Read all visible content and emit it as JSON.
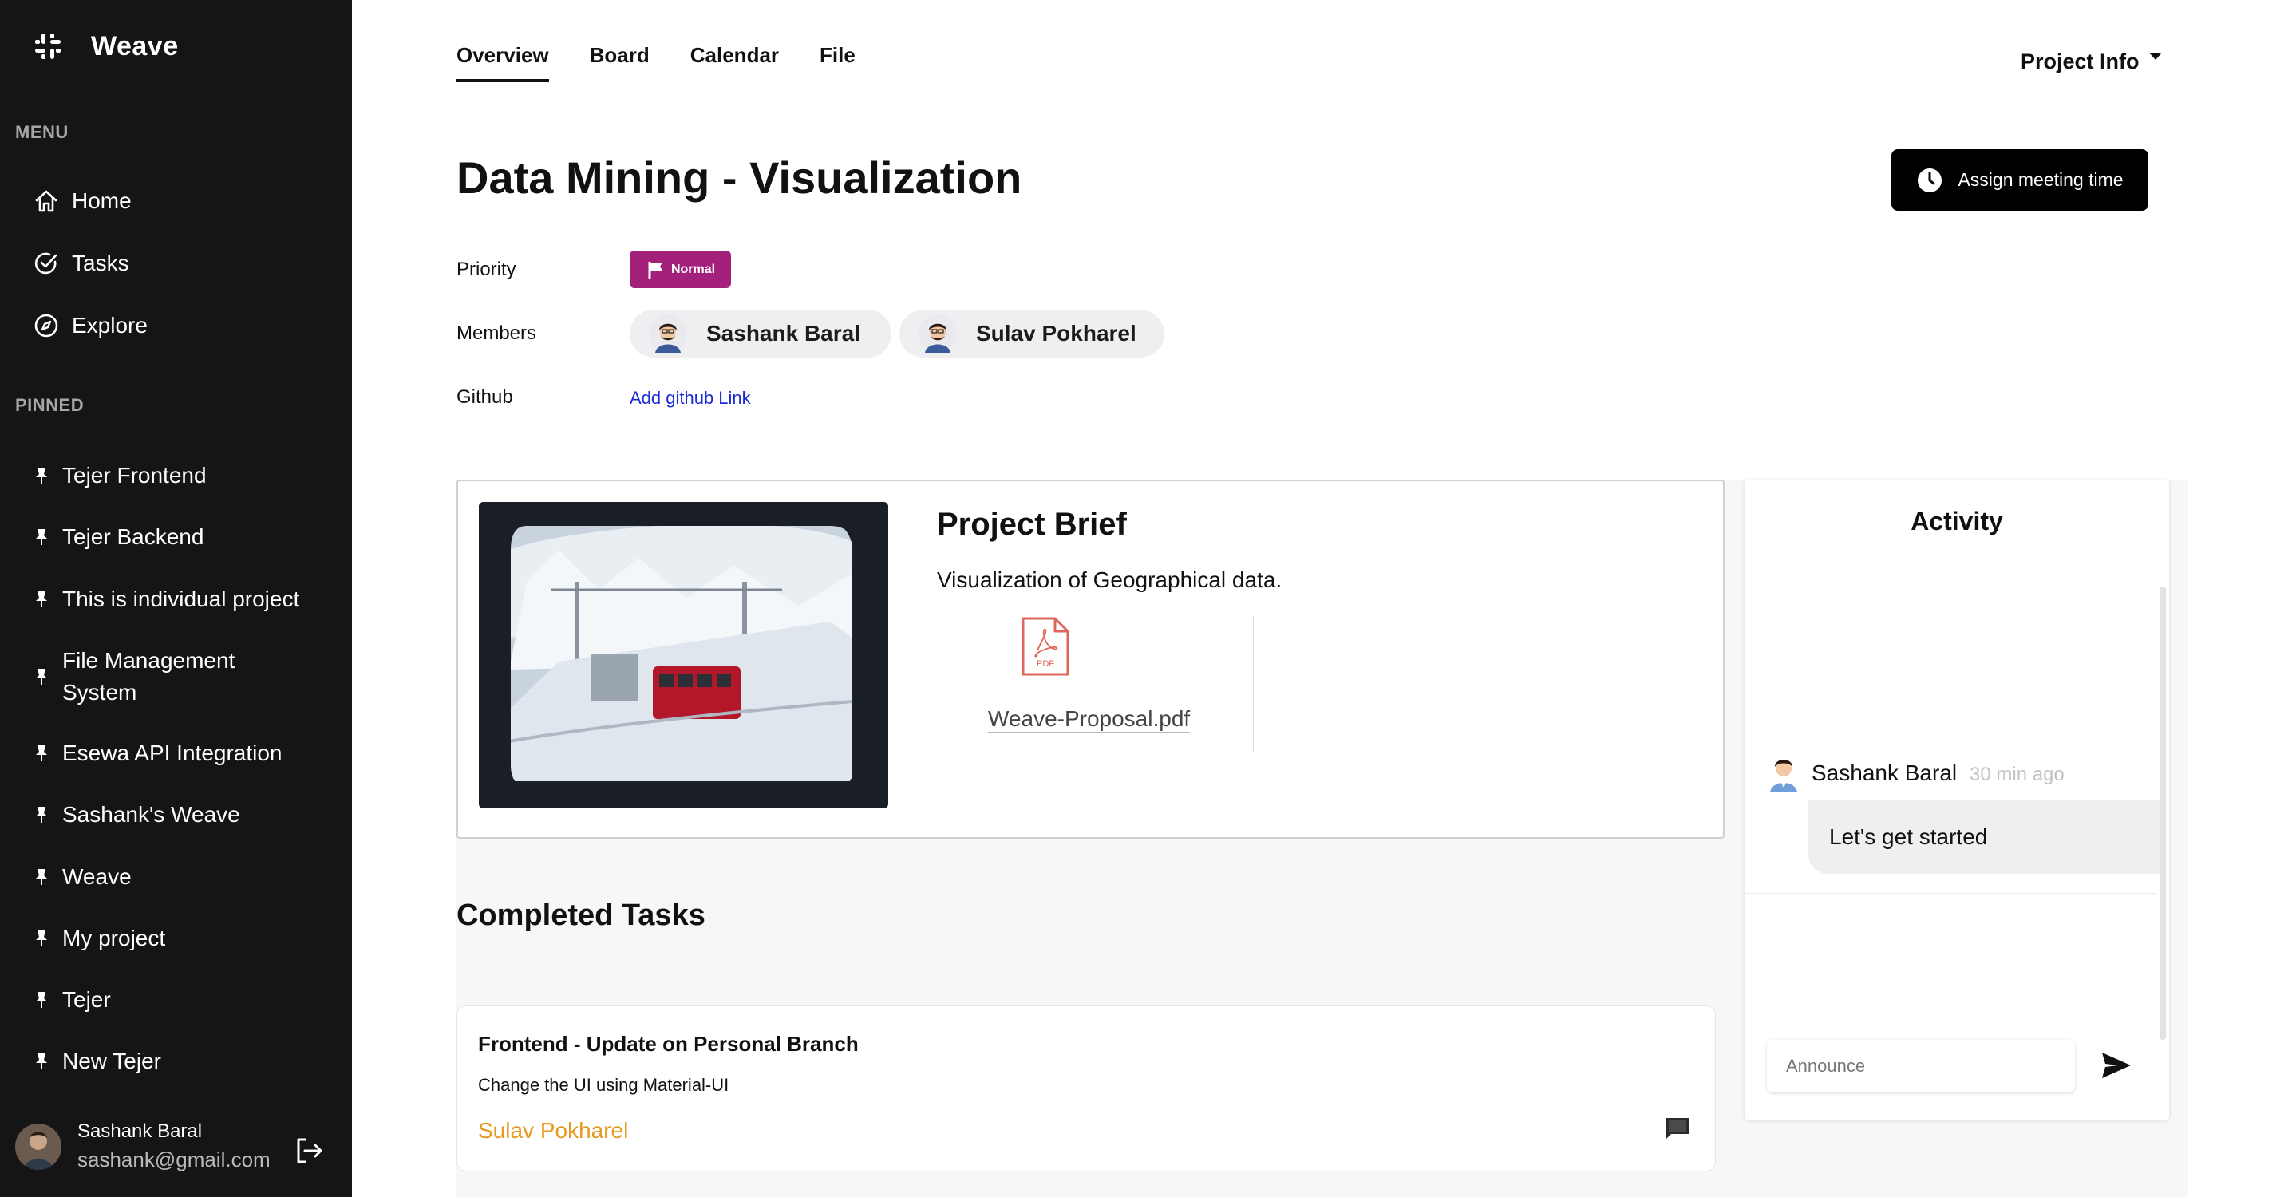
{
  "sidebar": {
    "brand": "Weave",
    "menu_label": "MENU",
    "menu": [
      {
        "label": "Home",
        "icon": "home-icon"
      },
      {
        "label": "Tasks",
        "icon": "check-circle-icon"
      },
      {
        "label": "Explore",
        "icon": "compass-icon"
      }
    ],
    "pinned_label": "PINNED",
    "pinned": [
      "Tejer Frontend",
      "Tejer Backend",
      "This is individual project",
      "File Management System",
      "Esewa API Integration",
      "Sashank's Weave",
      "Weave",
      "My project",
      "Tejer",
      "New Tejer"
    ],
    "user": {
      "name": "Sashank Baral",
      "email": "sashank@gmail.com"
    }
  },
  "tabs": [
    "Overview",
    "Board",
    "Calendar",
    "File"
  ],
  "active_tab": "Overview",
  "project_info_label": "Project Info",
  "project": {
    "title": "Data Mining - Visualization",
    "assign_button": "Assign meeting time",
    "priority_label": "Priority",
    "priority_value": "Normal",
    "priority_color": "#a3217a",
    "members_label": "Members",
    "members": [
      "Sashank Baral",
      "Sulav Pokharel"
    ],
    "github_label": "Github",
    "github_link": "Add github Link"
  },
  "brief": {
    "title": "Project Brief",
    "description": "Visualization of Geographical data.",
    "attachment": "Weave-Proposal.pdf",
    "attachment_icon_text": "PDF"
  },
  "completed": {
    "title": "Completed Tasks",
    "tasks": [
      {
        "title": "Frontend - Update on Personal Branch",
        "description": "Change the UI using Material-UI",
        "assignee": "Sulav Pokharel"
      }
    ]
  },
  "activity": {
    "title": "Activity",
    "messages": [
      {
        "author": "Sashank Baral",
        "time": "30 min ago",
        "text": "Let's get started"
      }
    ],
    "input_placeholder": "Announce"
  }
}
